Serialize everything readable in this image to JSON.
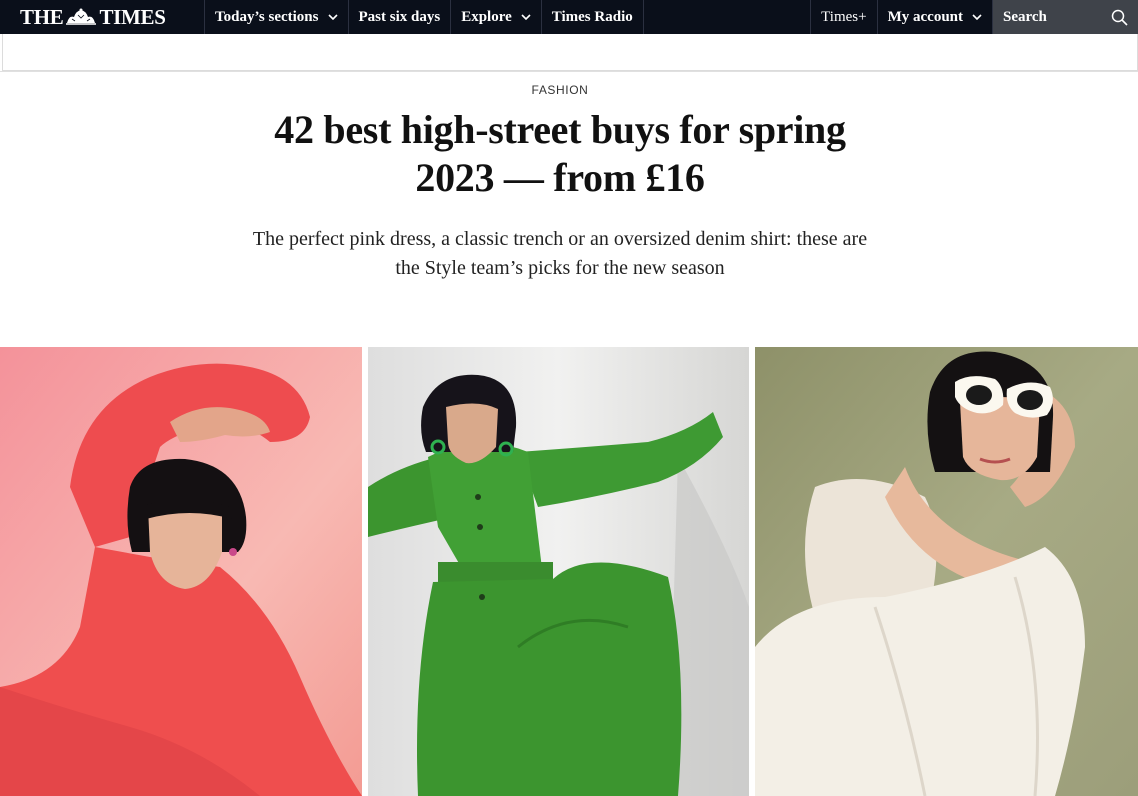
{
  "masthead": {
    "logo_left": "THE",
    "logo_right": "TIMES"
  },
  "nav": {
    "todays_sections": "Today’s sections",
    "past_six_days": "Past six days",
    "explore": "Explore",
    "times_radio": "Times Radio",
    "times_plus": "Times+",
    "my_account": "My account",
    "search_placeholder": "Search"
  },
  "article": {
    "section": "FASHION",
    "headline": "42 best high-street buys for spring 2023 — from £16",
    "standfirst": "The perfect pink dress, a classic trench or an oversized denim shirt: these are the Style team’s picks for the new season"
  },
  "colors": {
    "nav_bg": "#0a0f1a",
    "search_bg": "#3f434a",
    "photo1_bg": "#f6a7a4",
    "photo1_garment": "#f0514f",
    "photo2_bg": "#e9e9e7",
    "photo2_garment": "#3e9a35",
    "photo3_bg": "#9fa27c",
    "photo3_garment": "#f1ede4"
  },
  "icons": {
    "search": "search-icon",
    "dropdown": "chevron-down-icon",
    "crest": "royal-crest-icon"
  }
}
